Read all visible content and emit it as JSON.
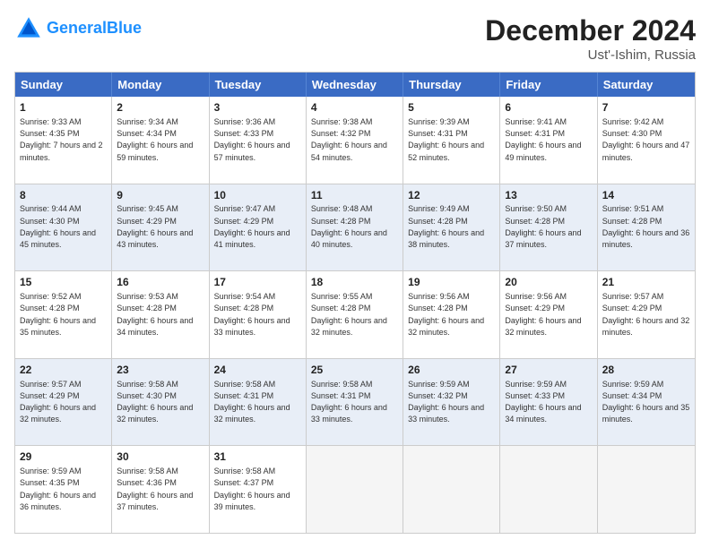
{
  "header": {
    "logo_line1": "General",
    "logo_line2": "Blue",
    "month": "December 2024",
    "location": "Ust'-Ishim, Russia"
  },
  "days_of_week": [
    "Sunday",
    "Monday",
    "Tuesday",
    "Wednesday",
    "Thursday",
    "Friday",
    "Saturday"
  ],
  "weeks": [
    [
      {
        "day": "1",
        "sunrise": "Sunrise: 9:33 AM",
        "sunset": "Sunset: 4:35 PM",
        "daylight": "Daylight: 7 hours and 2 minutes."
      },
      {
        "day": "2",
        "sunrise": "Sunrise: 9:34 AM",
        "sunset": "Sunset: 4:34 PM",
        "daylight": "Daylight: 6 hours and 59 minutes."
      },
      {
        "day": "3",
        "sunrise": "Sunrise: 9:36 AM",
        "sunset": "Sunset: 4:33 PM",
        "daylight": "Daylight: 6 hours and 57 minutes."
      },
      {
        "day": "4",
        "sunrise": "Sunrise: 9:38 AM",
        "sunset": "Sunset: 4:32 PM",
        "daylight": "Daylight: 6 hours and 54 minutes."
      },
      {
        "day": "5",
        "sunrise": "Sunrise: 9:39 AM",
        "sunset": "Sunset: 4:31 PM",
        "daylight": "Daylight: 6 hours and 52 minutes."
      },
      {
        "day": "6",
        "sunrise": "Sunrise: 9:41 AM",
        "sunset": "Sunset: 4:31 PM",
        "daylight": "Daylight: 6 hours and 49 minutes."
      },
      {
        "day": "7",
        "sunrise": "Sunrise: 9:42 AM",
        "sunset": "Sunset: 4:30 PM",
        "daylight": "Daylight: 6 hours and 47 minutes."
      }
    ],
    [
      {
        "day": "8",
        "sunrise": "Sunrise: 9:44 AM",
        "sunset": "Sunset: 4:30 PM",
        "daylight": "Daylight: 6 hours and 45 minutes."
      },
      {
        "day": "9",
        "sunrise": "Sunrise: 9:45 AM",
        "sunset": "Sunset: 4:29 PM",
        "daylight": "Daylight: 6 hours and 43 minutes."
      },
      {
        "day": "10",
        "sunrise": "Sunrise: 9:47 AM",
        "sunset": "Sunset: 4:29 PM",
        "daylight": "Daylight: 6 hours and 41 minutes."
      },
      {
        "day": "11",
        "sunrise": "Sunrise: 9:48 AM",
        "sunset": "Sunset: 4:28 PM",
        "daylight": "Daylight: 6 hours and 40 minutes."
      },
      {
        "day": "12",
        "sunrise": "Sunrise: 9:49 AM",
        "sunset": "Sunset: 4:28 PM",
        "daylight": "Daylight: 6 hours and 38 minutes."
      },
      {
        "day": "13",
        "sunrise": "Sunrise: 9:50 AM",
        "sunset": "Sunset: 4:28 PM",
        "daylight": "Daylight: 6 hours and 37 minutes."
      },
      {
        "day": "14",
        "sunrise": "Sunrise: 9:51 AM",
        "sunset": "Sunset: 4:28 PM",
        "daylight": "Daylight: 6 hours and 36 minutes."
      }
    ],
    [
      {
        "day": "15",
        "sunrise": "Sunrise: 9:52 AM",
        "sunset": "Sunset: 4:28 PM",
        "daylight": "Daylight: 6 hours and 35 minutes."
      },
      {
        "day": "16",
        "sunrise": "Sunrise: 9:53 AM",
        "sunset": "Sunset: 4:28 PM",
        "daylight": "Daylight: 6 hours and 34 minutes."
      },
      {
        "day": "17",
        "sunrise": "Sunrise: 9:54 AM",
        "sunset": "Sunset: 4:28 PM",
        "daylight": "Daylight: 6 hours and 33 minutes."
      },
      {
        "day": "18",
        "sunrise": "Sunrise: 9:55 AM",
        "sunset": "Sunset: 4:28 PM",
        "daylight": "Daylight: 6 hours and 32 minutes."
      },
      {
        "day": "19",
        "sunrise": "Sunrise: 9:56 AM",
        "sunset": "Sunset: 4:28 PM",
        "daylight": "Daylight: 6 hours and 32 minutes."
      },
      {
        "day": "20",
        "sunrise": "Sunrise: 9:56 AM",
        "sunset": "Sunset: 4:29 PM",
        "daylight": "Daylight: 6 hours and 32 minutes."
      },
      {
        "day": "21",
        "sunrise": "Sunrise: 9:57 AM",
        "sunset": "Sunset: 4:29 PM",
        "daylight": "Daylight: 6 hours and 32 minutes."
      }
    ],
    [
      {
        "day": "22",
        "sunrise": "Sunrise: 9:57 AM",
        "sunset": "Sunset: 4:29 PM",
        "daylight": "Daylight: 6 hours and 32 minutes."
      },
      {
        "day": "23",
        "sunrise": "Sunrise: 9:58 AM",
        "sunset": "Sunset: 4:30 PM",
        "daylight": "Daylight: 6 hours and 32 minutes."
      },
      {
        "day": "24",
        "sunrise": "Sunrise: 9:58 AM",
        "sunset": "Sunset: 4:31 PM",
        "daylight": "Daylight: 6 hours and 32 minutes."
      },
      {
        "day": "25",
        "sunrise": "Sunrise: 9:58 AM",
        "sunset": "Sunset: 4:31 PM",
        "daylight": "Daylight: 6 hours and 33 minutes."
      },
      {
        "day": "26",
        "sunrise": "Sunrise: 9:59 AM",
        "sunset": "Sunset: 4:32 PM",
        "daylight": "Daylight: 6 hours and 33 minutes."
      },
      {
        "day": "27",
        "sunrise": "Sunrise: 9:59 AM",
        "sunset": "Sunset: 4:33 PM",
        "daylight": "Daylight: 6 hours and 34 minutes."
      },
      {
        "day": "28",
        "sunrise": "Sunrise: 9:59 AM",
        "sunset": "Sunset: 4:34 PM",
        "daylight": "Daylight: 6 hours and 35 minutes."
      }
    ],
    [
      {
        "day": "29",
        "sunrise": "Sunrise: 9:59 AM",
        "sunset": "Sunset: 4:35 PM",
        "daylight": "Daylight: 6 hours and 36 minutes."
      },
      {
        "day": "30",
        "sunrise": "Sunrise: 9:58 AM",
        "sunset": "Sunset: 4:36 PM",
        "daylight": "Daylight: 6 hours and 37 minutes."
      },
      {
        "day": "31",
        "sunrise": "Sunrise: 9:58 AM",
        "sunset": "Sunset: 4:37 PM",
        "daylight": "Daylight: 6 hours and 39 minutes."
      },
      {
        "day": "",
        "sunrise": "",
        "sunset": "",
        "daylight": ""
      },
      {
        "day": "",
        "sunrise": "",
        "sunset": "",
        "daylight": ""
      },
      {
        "day": "",
        "sunrise": "",
        "sunset": "",
        "daylight": ""
      },
      {
        "day": "",
        "sunrise": "",
        "sunset": "",
        "daylight": ""
      }
    ]
  ]
}
